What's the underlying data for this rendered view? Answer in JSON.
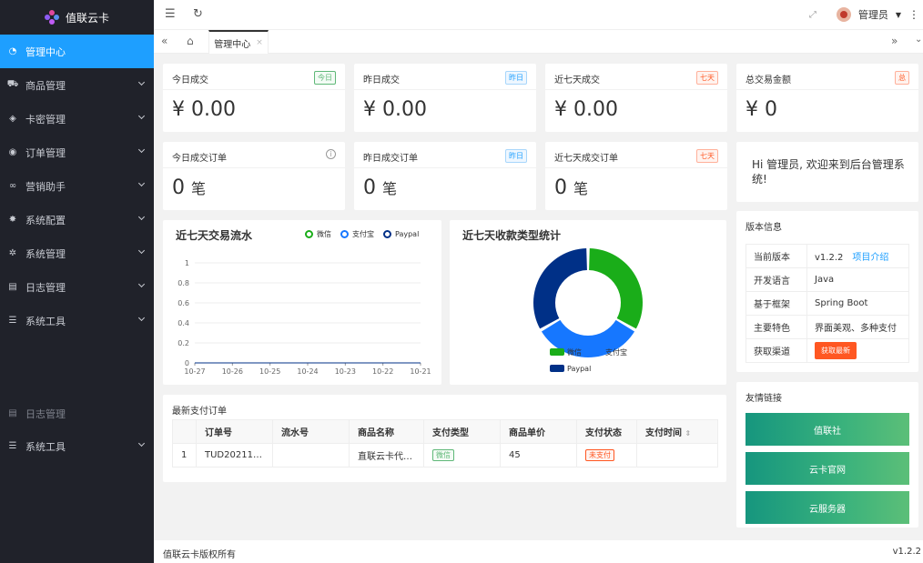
{
  "app": {
    "logo_text": "值联云卡"
  },
  "sidebar": {
    "items": [
      {
        "label": "管理中心",
        "icon": "dashboard-icon"
      },
      {
        "label": "商品管理",
        "icon": "cart-icon"
      },
      {
        "label": "卡密管理",
        "icon": "layers-icon"
      },
      {
        "label": "订单管理",
        "icon": "order-icon"
      },
      {
        "label": "营销助手",
        "icon": "link-icon"
      },
      {
        "label": "系统配置",
        "icon": "gear-icon"
      },
      {
        "label": "系统管理",
        "icon": "settings-icon"
      },
      {
        "label": "日志管理",
        "icon": "log-icon"
      },
      {
        "label": "系统工具",
        "icon": "tools-icon"
      }
    ],
    "ghost_label": "日志管理",
    "extra_item": {
      "label": "系统工具"
    }
  },
  "header": {
    "user": "管理员"
  },
  "tabs": {
    "active": "管理中心",
    "close": "×"
  },
  "stats": [
    {
      "title": "今日成交",
      "badge": "今日",
      "value": "¥ 0.00"
    },
    {
      "title": "昨日成交",
      "badge": "昨日",
      "value": "¥ 0.00"
    },
    {
      "title": "近七天成交",
      "badge": "七天",
      "value": "¥ 0.00"
    },
    {
      "title": "总交易金额",
      "badge": "总",
      "value": "¥ 0"
    },
    {
      "title": "今日成交订单",
      "value": "0",
      "unit": "笔"
    },
    {
      "title": "昨日成交订单",
      "badge": "昨日",
      "value": "0",
      "unit": "笔"
    },
    {
      "title": "近七天成交订单",
      "badge": "七天",
      "value": "0",
      "unit": "笔"
    }
  ],
  "welcome": "Hi 管理员, 欢迎来到后台管理系统!",
  "version": {
    "title": "版本信息",
    "rows": [
      {
        "label": "当前版本",
        "value": "v1.2.2",
        "link": "项目介绍"
      },
      {
        "label": "开发语言",
        "value": "Java"
      },
      {
        "label": "基于框架",
        "value": "Spring Boot"
      },
      {
        "label": "主要特色",
        "value": "界面美观、多种支付"
      },
      {
        "label": "获取渠道",
        "button": "获取最新"
      }
    ]
  },
  "friends": {
    "title": "友情链接",
    "links": [
      "值联社",
      "云卡官网",
      "云服务器"
    ]
  },
  "orders": {
    "title": "最新支付订单",
    "columns": [
      "订单号",
      "流水号",
      "商品名称",
      "支付类型",
      "商品单价",
      "支付状态",
      "支付时间"
    ],
    "rows": [
      {
        "index": "1",
        "order_no": "TUD20211…",
        "serial": "",
        "product": "直联云卡代…",
        "pay_type": "微信",
        "price": "45",
        "status": "未支付",
        "time": ""
      }
    ]
  },
  "footer": {
    "copyright": "值联云卡版权所有",
    "version": "v1.2.2"
  },
  "colors": {
    "wechat": "#1aad19",
    "alipay": "#1677ff",
    "paypal": "#003087",
    "accent": "#1e9fff"
  },
  "chart_data": [
    {
      "type": "line",
      "title": "近七天交易流水",
      "x": [
        "10-27",
        "10-26",
        "10-25",
        "10-24",
        "10-23",
        "10-22",
        "10-21"
      ],
      "series": [
        {
          "name": "微信",
          "values": [
            0,
            0,
            0,
            0,
            0,
            0,
            0
          ]
        },
        {
          "name": "支付宝",
          "values": [
            0,
            0,
            0,
            0,
            0,
            0,
            0
          ]
        },
        {
          "name": "Paypal",
          "values": [
            0,
            0,
            0,
            0,
            0,
            0,
            0
          ]
        }
      ],
      "yticks": [
        "0",
        "0.2",
        "0.4",
        "0.6",
        "0.8",
        "1"
      ],
      "ylim": [
        0,
        1
      ],
      "legend": "top-right"
    },
    {
      "type": "pie",
      "title": "近七天收款类型统计",
      "labels": [
        "微信",
        "支付宝",
        "Paypal"
      ],
      "values": [
        1,
        1,
        1
      ],
      "legend": "bottom"
    }
  ]
}
